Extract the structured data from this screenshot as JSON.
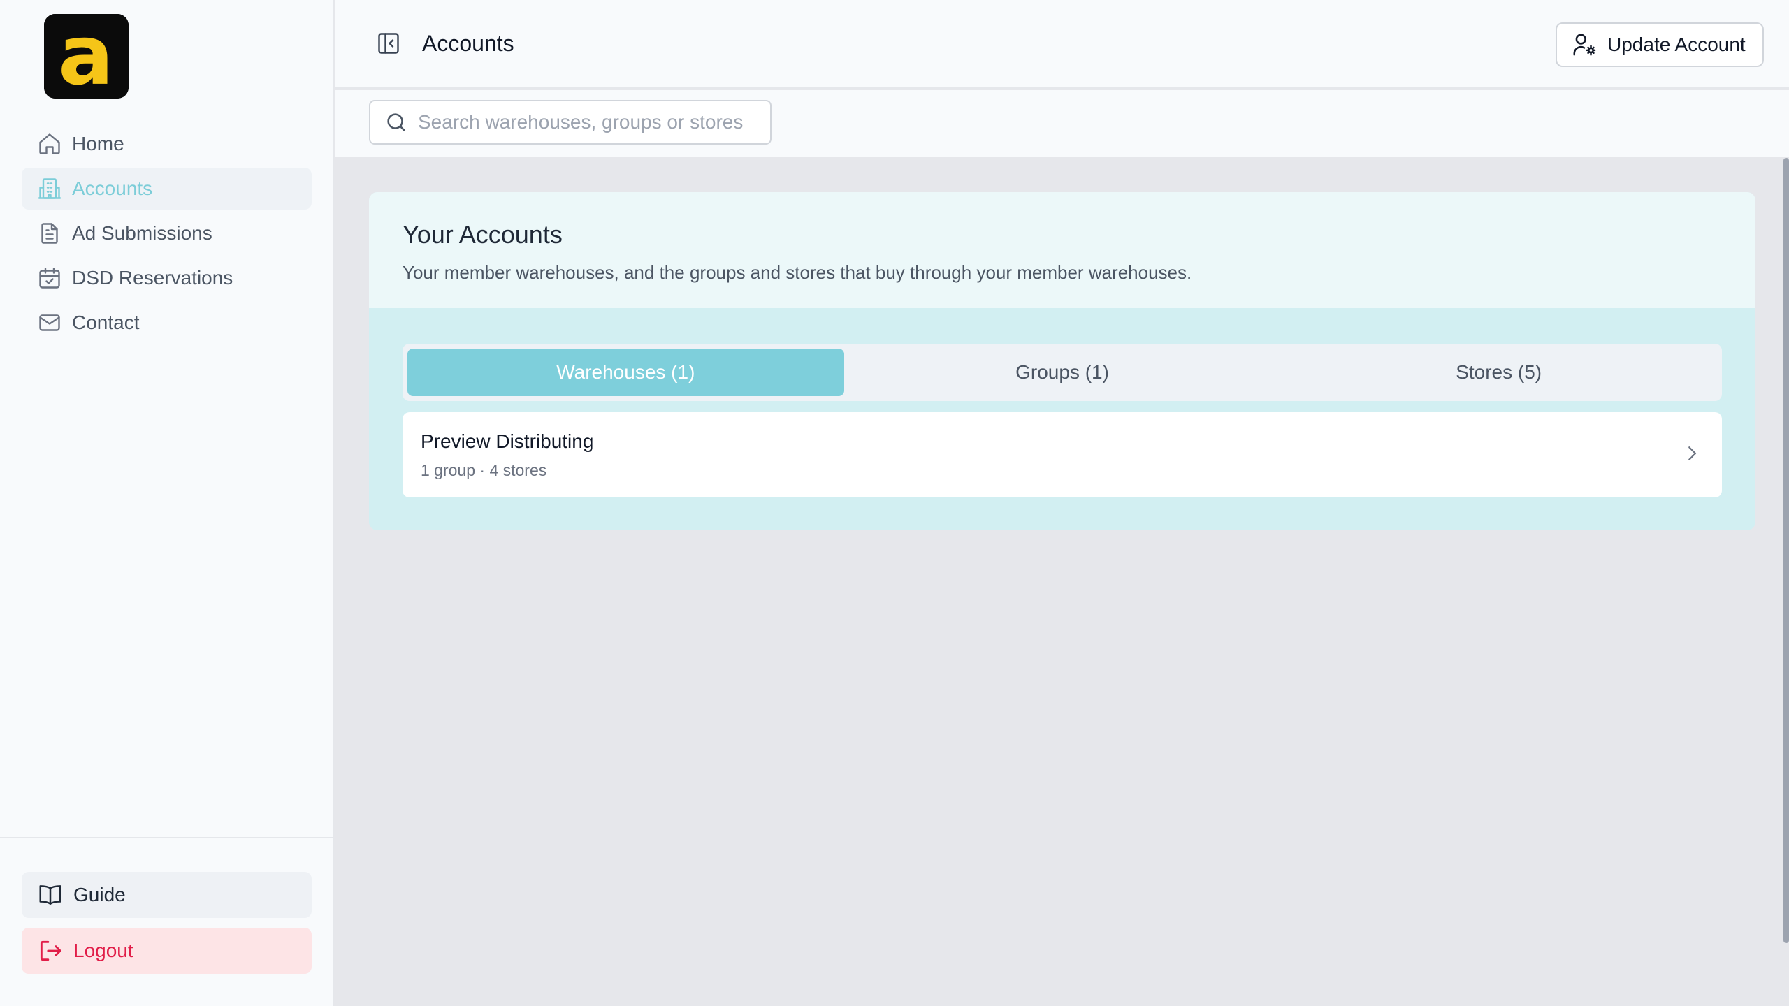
{
  "brand": {
    "logo_letter": "a"
  },
  "sidebar": {
    "items": [
      {
        "label": "Home",
        "icon": "home-icon"
      },
      {
        "label": "Accounts",
        "icon": "building-icon",
        "active": true
      },
      {
        "label": "Ad Submissions",
        "icon": "document-icon"
      },
      {
        "label": "DSD Reservations",
        "icon": "calendar-check-icon"
      },
      {
        "label": "Contact",
        "icon": "mail-icon"
      }
    ],
    "guide_label": "Guide",
    "logout_label": "Logout"
  },
  "header": {
    "title": "Accounts",
    "update_button": "Update Account"
  },
  "search": {
    "placeholder": "Search warehouses, groups or stores",
    "value": ""
  },
  "accounts": {
    "title": "Your Accounts",
    "description": "Your member warehouses, and the groups and stores that buy through your member warehouses.",
    "tabs": [
      {
        "label": "Warehouses (1)",
        "active": true
      },
      {
        "label": "Groups (1)"
      },
      {
        "label": "Stores (5)"
      }
    ],
    "rows": [
      {
        "name": "Preview Distributing",
        "meta": "1 group · 4 stores"
      }
    ]
  },
  "colors": {
    "accent": "#7ecfdb",
    "logout": "#e11d48",
    "logo_yellow": "#f5c518"
  }
}
